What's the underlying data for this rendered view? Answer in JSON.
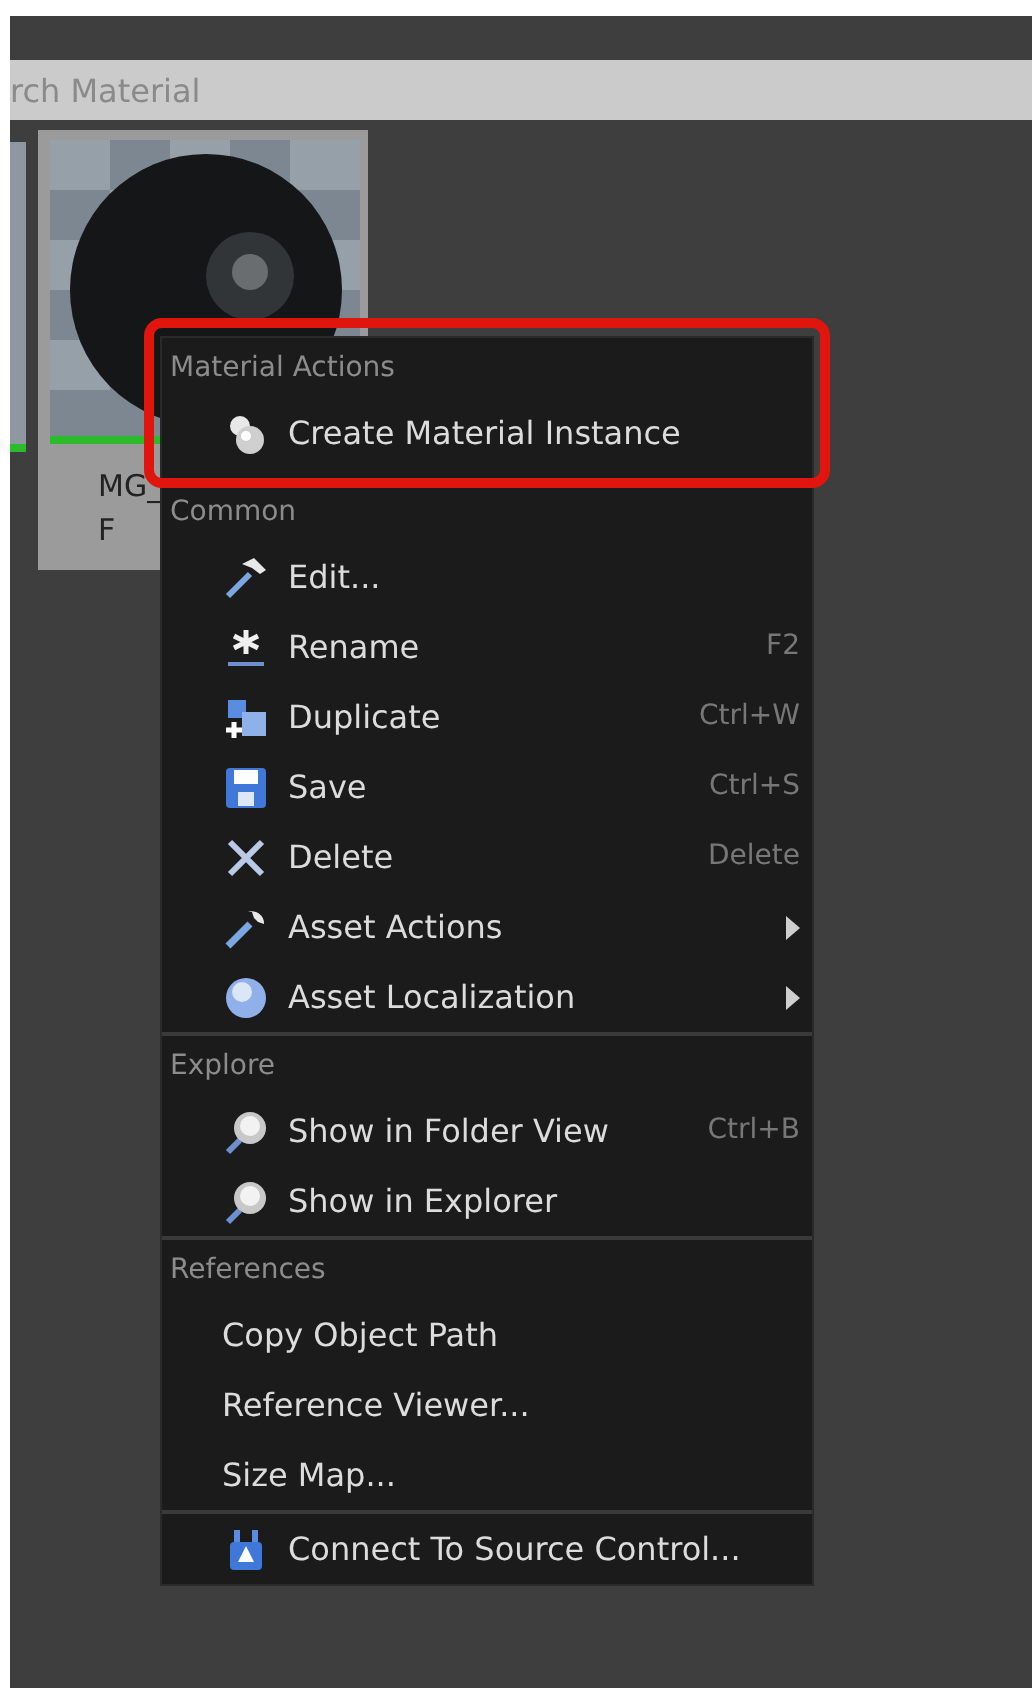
{
  "search": {
    "value": "rch Material"
  },
  "asset": {
    "label_lines": [
      "MG_",
      "F"
    ]
  },
  "menu": {
    "sections": [
      {
        "title": "Material Actions",
        "highlighted": true,
        "items": [
          {
            "label": "Create Material Instance",
            "kind": "instance"
          }
        ]
      },
      {
        "title": "Common",
        "items": [
          {
            "label": "Edit...",
            "kind": "edit"
          },
          {
            "label": "Rename",
            "kind": "rename",
            "shortcut": "F2"
          },
          {
            "label": "Duplicate",
            "kind": "duplicate",
            "shortcut": "Ctrl+W"
          },
          {
            "label": "Save",
            "kind": "save",
            "shortcut": "Ctrl+S"
          },
          {
            "label": "Delete",
            "kind": "delete",
            "shortcut": "Delete"
          },
          {
            "label": "Asset Actions",
            "kind": "tool",
            "submenu": true
          },
          {
            "label": "Asset Localization",
            "kind": "globe",
            "submenu": true
          }
        ]
      },
      {
        "title": "Explore",
        "separator_above": true,
        "items": [
          {
            "label": "Show in Folder View",
            "kind": "find",
            "shortcut": "Ctrl+B"
          },
          {
            "label": "Show in Explorer",
            "kind": "find"
          }
        ]
      },
      {
        "title": "References",
        "separator_above": true,
        "items": [
          {
            "label": "Copy Object Path",
            "kind": "plain"
          },
          {
            "label": "Reference Viewer...",
            "kind": "plain"
          },
          {
            "label": "Size Map...",
            "kind": "plain"
          }
        ]
      },
      {
        "separator_above": true,
        "items": [
          {
            "label": "Connect To Source Control...",
            "kind": "plug"
          }
        ]
      }
    ]
  }
}
